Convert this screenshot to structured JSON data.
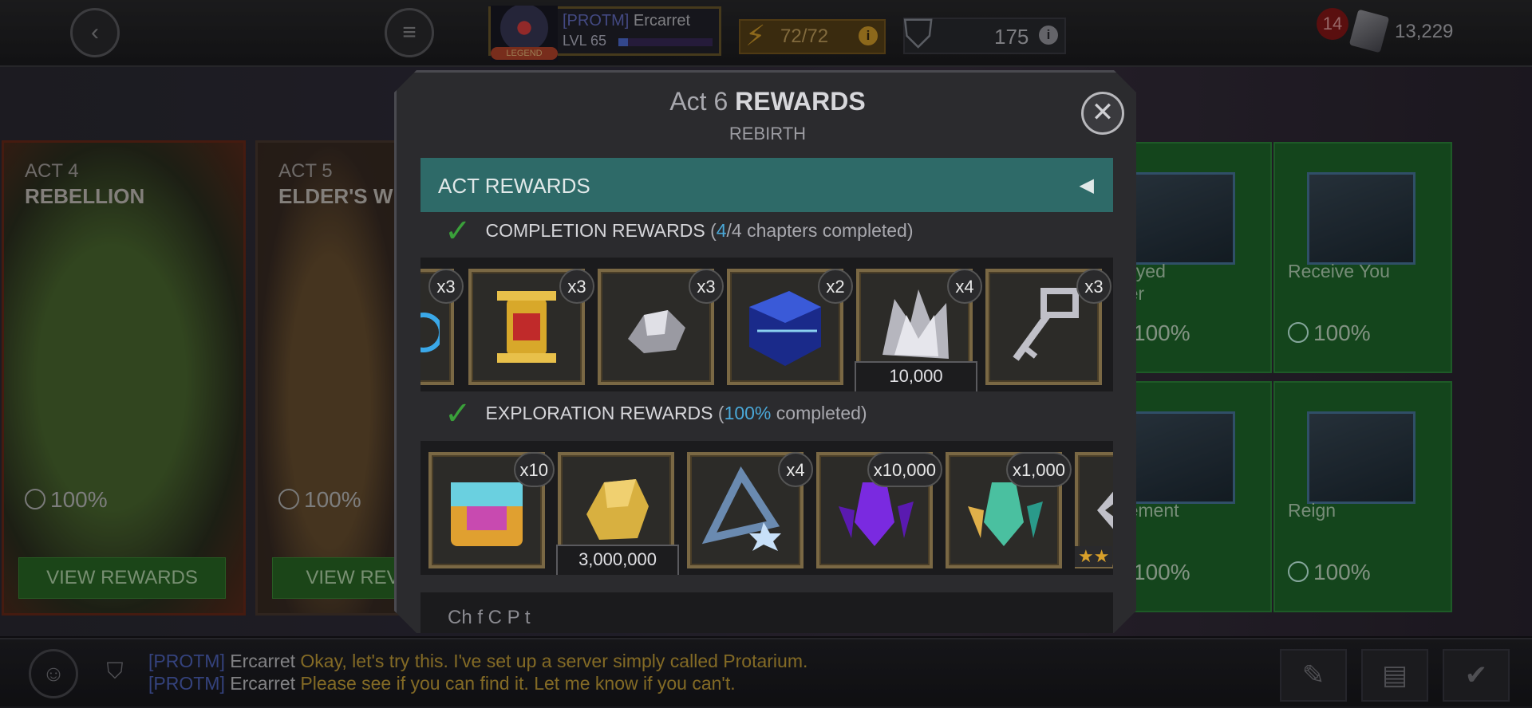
{
  "topbar": {
    "back_icon": "chevron-left-icon",
    "menu_icon": "hamburger-icon",
    "profile": {
      "alliance_tag": "[PROTM]",
      "name": "Ercarret",
      "level": "LVL 65",
      "badge": "LEGEND",
      "xp_fraction": 0.1
    },
    "energy": {
      "value": "72/72",
      "info": "i"
    },
    "shield": {
      "value": "175",
      "info": "i"
    },
    "notifications": "14",
    "gold": "13,229"
  },
  "background": {
    "acts": [
      {
        "num": "ACT 4",
        "title": "REBELLION",
        "pct": "100%",
        "button": "VIEW REWARDS"
      },
      {
        "num": "ACT 5",
        "title": "ELDER'S W",
        "pct": "100%",
        "button": "VIEW REV"
      }
    ],
    "quests": [
      {
        "label_line1": "e-Eyed",
        "label_line2": "gger",
        "pct": "100%"
      },
      {
        "label_line1": "Receive You",
        "label_line2": "",
        "pct": "100%"
      },
      {
        "label_line1": "dgement",
        "label_line2": "",
        "pct": "100%"
      },
      {
        "label_line1": "Reign",
        "label_line2": "",
        "pct": "100%"
      }
    ]
  },
  "modal": {
    "title_prefix": "Act 6",
    "title_main": "REWARDS",
    "subtitle": "REBIRTH",
    "section": {
      "label": "ACT REWARDS",
      "arrow": "◀"
    },
    "completion": {
      "label": "COMPLETION REWARDS",
      "open": "(",
      "done": "4",
      "rest": "/4 chapters completed)",
      "items": [
        {
          "icon": "crystal-partial-icon",
          "count": "x3"
        },
        {
          "icon": "gold-relic-icon",
          "count": "x3"
        },
        {
          "icon": "silver-shard-icon",
          "count": "x3"
        },
        {
          "icon": "blue-crystal-icon",
          "count": "x2"
        },
        {
          "icon": "silver-catalyst-icon",
          "count": "x4",
          "amount": "10,000"
        },
        {
          "icon": "key-icon",
          "count": "x3"
        }
      ]
    },
    "exploration": {
      "label": "EXPLORATION REWARDS",
      "open": "(",
      "done": "100%",
      "rest": " completed)",
      "items": [
        {
          "icon": "rainbow-crystal-icon",
          "count": "x10"
        },
        {
          "icon": "gold-nugget-icon",
          "amount": "3,000,000"
        },
        {
          "icon": "sigil-crystal-icon",
          "count": "x4"
        },
        {
          "icon": "purple-shard-icon",
          "count": "x10,000"
        },
        {
          "icon": "teal-shard-icon",
          "count": "x1,000"
        },
        {
          "icon": "star-item-icon",
          "stars": "★★"
        }
      ]
    },
    "next_section_label": "Ch      f   C   P     t"
  },
  "chat": {
    "lines": [
      {
        "tag": "[PROTM]",
        "who": "Ercarret",
        "msg": "Okay, let's try this. I've set up a server simply called Protarium."
      },
      {
        "tag": "[PROTM]",
        "who": "Ercarret",
        "msg": "Please see if you can find it. Let me know if you can't."
      }
    ]
  },
  "colors": {
    "accent_teal": "#2e6a68",
    "highlight_blue": "#4aa8d8",
    "quest_green": "#1f6a2c",
    "gold": "#d8a02a"
  }
}
